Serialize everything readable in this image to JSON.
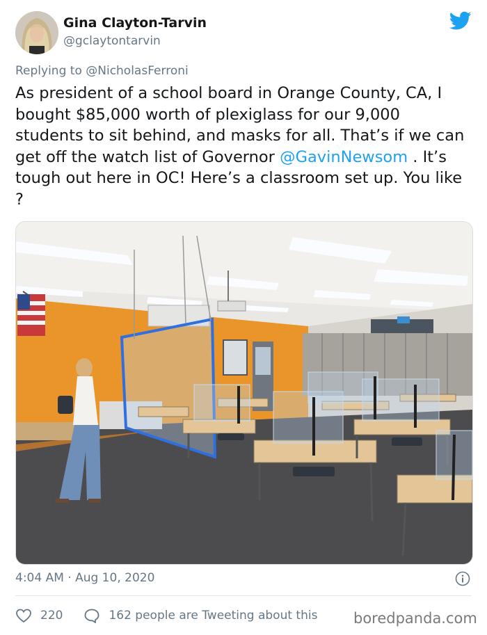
{
  "author": {
    "name": "Gina Clayton-Tarvin",
    "handle": "@gclaytontarvin"
  },
  "reply": {
    "prefix": "Replying to ",
    "mention": "@NicholasFerroni"
  },
  "tweet": {
    "text_before": "As president of a school board in Orange County, CA, I bought $85,000 worth of plexiglass for our 9,000 students to sit behind, and masks for all. That’s if we can get off the watch list of Governor ",
    "mention": "@GavinNewsom",
    "text_after": " . It’s tough out here in OC! Here’s a classroom set up. You like ?"
  },
  "meta": {
    "timestamp": "4:04 AM · Aug 10, 2020"
  },
  "actions": {
    "likes": "220",
    "comments": "162 people are Tweeting about this"
  },
  "watermark": "boredpanda.com",
  "icons": {
    "brand": "twitter-bird-icon",
    "info": "info-icon",
    "like": "heart-icon",
    "reply": "comment-icon"
  },
  "colors": {
    "brand_blue": "#1da1f2",
    "secondary_text": "#657786",
    "wall_orange": "#e9952a"
  }
}
